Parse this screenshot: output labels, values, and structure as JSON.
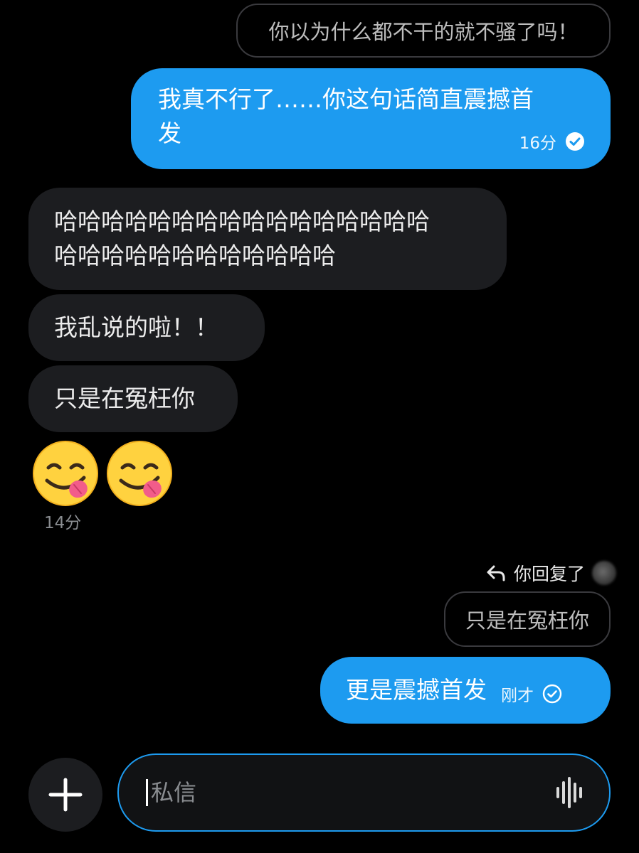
{
  "messages": {
    "quote_top": "你以为什么都不干的就不骚了吗！",
    "out_1": {
      "line1": "我真不行了……你这句话简直震撼首",
      "line2": "发",
      "time": "16分"
    },
    "in_1": {
      "line1": "哈哈哈哈哈哈哈哈哈哈哈哈哈哈哈哈",
      "line2": "哈哈哈哈哈哈哈哈哈哈哈哈"
    },
    "in_2": "我乱说的啦！！",
    "in_3": "只是在冤枉你",
    "in_emoji_names": [
      "face-savoring-food-emoji",
      "face-savoring-food-emoji"
    ],
    "in_time": "14分",
    "reply_label": "你回复了",
    "reply_quote": "只是在冤枉你",
    "out_2": {
      "text": "更是震撼首发",
      "time": "刚才"
    }
  },
  "composer": {
    "placeholder": "私信",
    "value": "",
    "plus_icon": "plus-icon",
    "voice_icon": "voice-waveform-icon"
  },
  "colors": {
    "background": "#000000",
    "outgoing_bubble": "#1d9bf0",
    "incoming_bubble": "#1c1d20",
    "composer_border": "#1d9bf0"
  }
}
